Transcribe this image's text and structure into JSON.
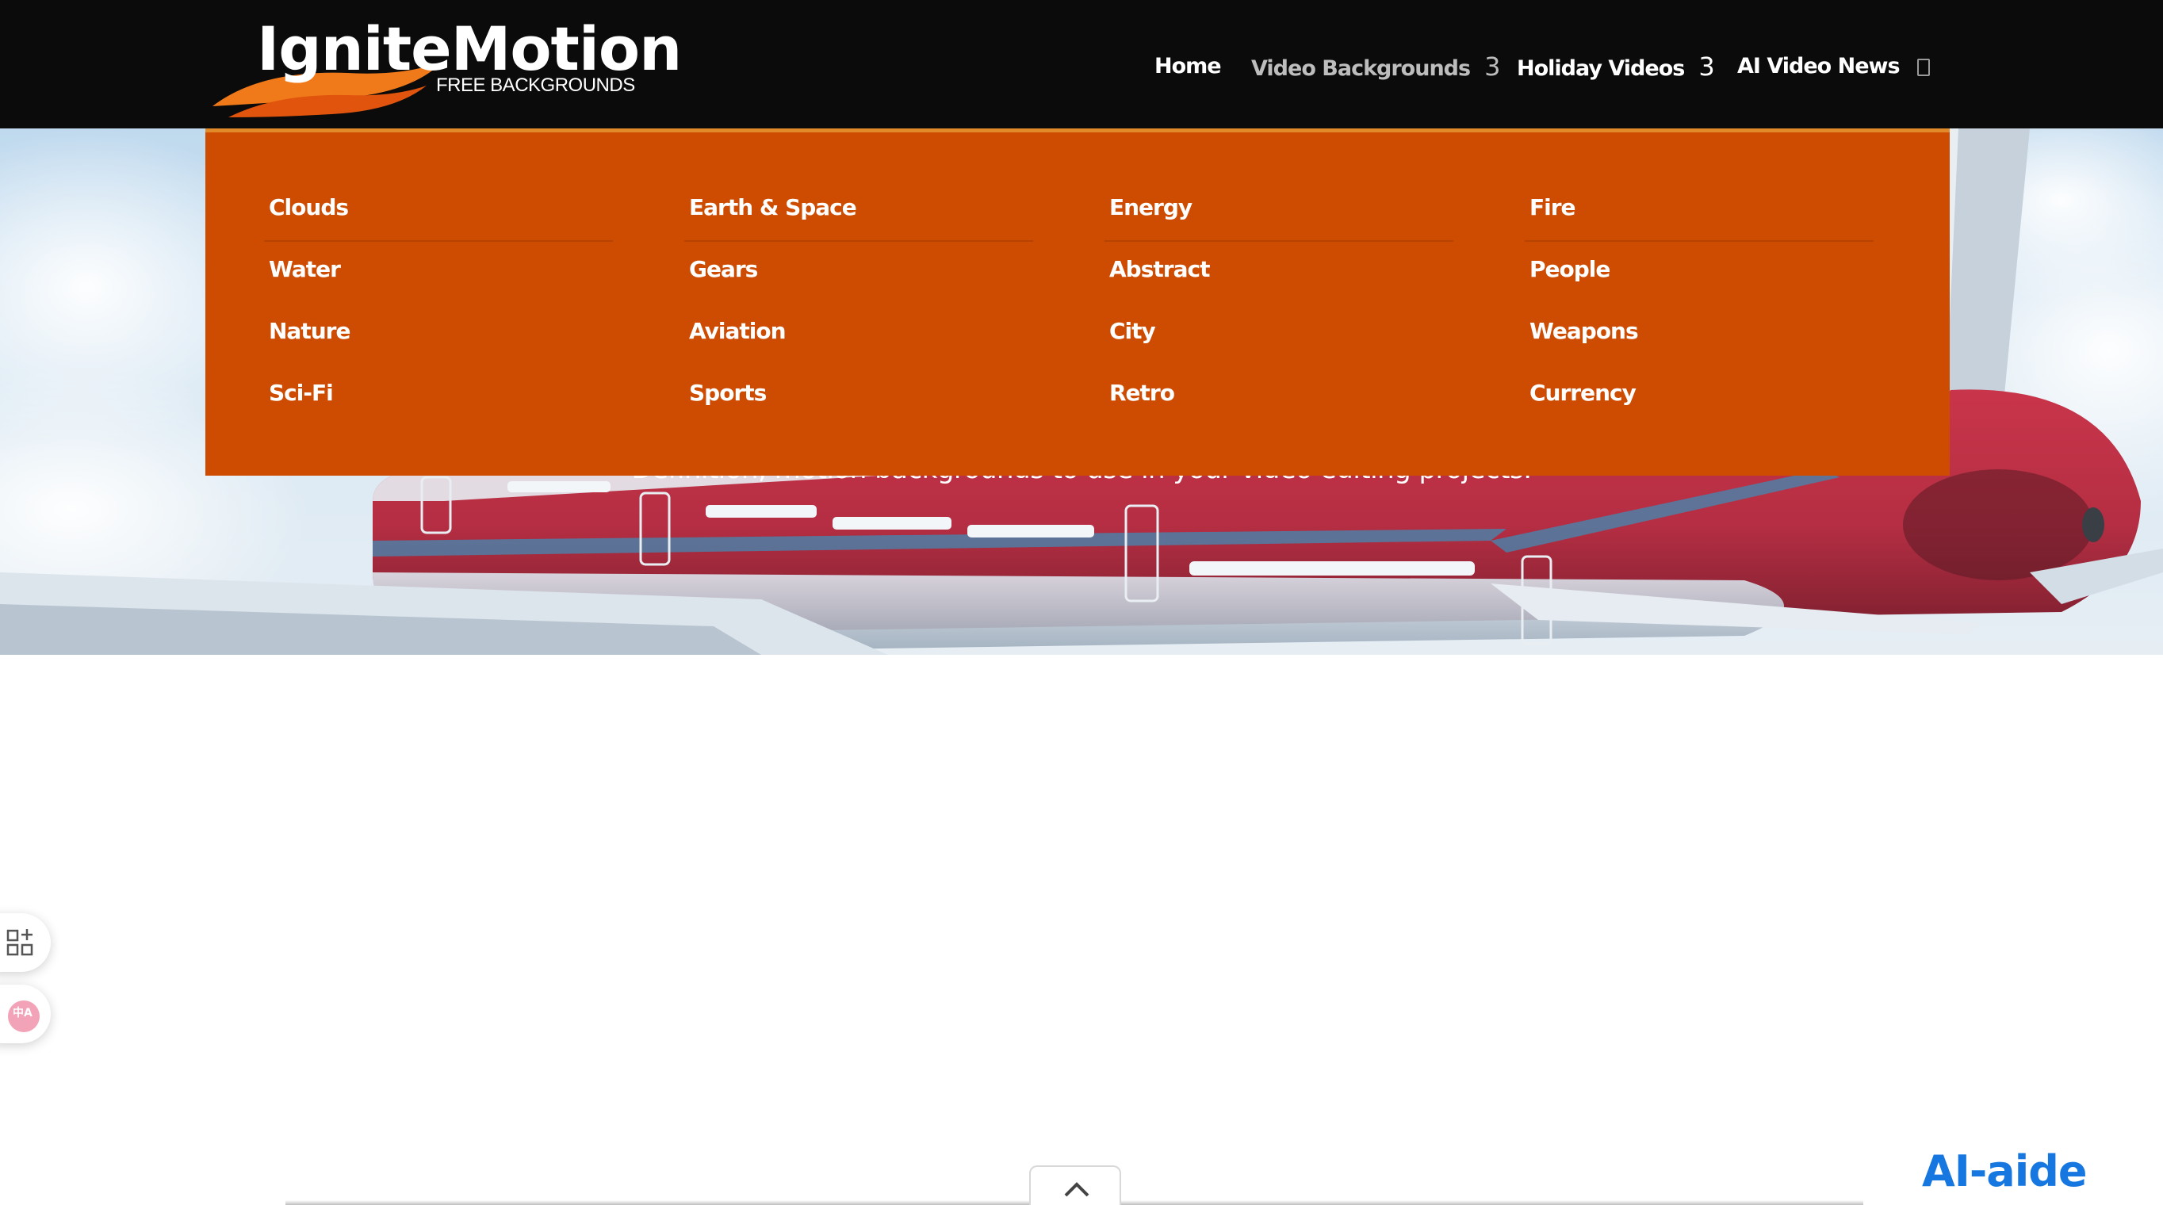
{
  "brand": {
    "name": "IgniteMotion",
    "tagline": "FREE BACKGROUNDS"
  },
  "nav": {
    "items": [
      {
        "label": "Home",
        "caret": ""
      },
      {
        "label": "Video Backgrounds",
        "caret": "3"
      },
      {
        "label": "Holiday Videos",
        "caret": "3"
      },
      {
        "label": "AI Video News",
        "caret": ""
      }
    ],
    "search_icon": "search-icon"
  },
  "mega_menu": {
    "columns": [
      [
        "Clouds",
        "Water",
        "Nature",
        "Sci-Fi"
      ],
      [
        "Earth & Space",
        "Gears",
        "Aviation",
        "Sports"
      ],
      [
        "Energy",
        "Abstract",
        "City",
        "Retro"
      ],
      [
        "Fire",
        "People",
        "Weapons",
        "Currency"
      ]
    ],
    "background_color": "#cd4c02"
  },
  "hero": {
    "subtitle": "Definition, motion backgrounds to use in your video editing projects."
  },
  "floating_tools": {
    "tool_1_icon": "grid-plus-icon",
    "tool_2_icon": "translate-icon",
    "tool_2_text": "中A"
  },
  "footer": {
    "scroll_top_icon": "chevron-up-icon",
    "badge": "AI-aide"
  }
}
